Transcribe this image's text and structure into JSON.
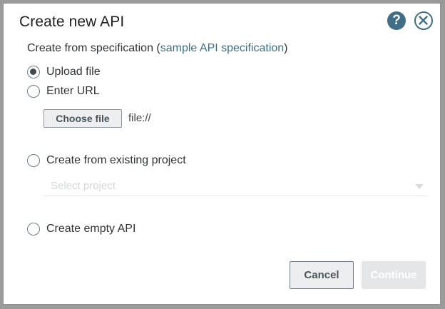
{
  "dialog": {
    "title": "Create new API",
    "help_icon": "question-mark-icon",
    "close_icon": "close-x-icon",
    "help_glyph": "?"
  },
  "spec": {
    "prefix": "Create from specification",
    "open_paren": " (",
    "link_text": "sample API specification",
    "close_paren": ")"
  },
  "options": {
    "upload_file": "Upload file",
    "enter_url": "Enter URL",
    "existing_project": "Create from existing project",
    "empty_api": "Create empty API",
    "selected": "upload_file"
  },
  "file_picker": {
    "button_label": "Choose file",
    "value": "file://"
  },
  "project_select": {
    "placeholder": "Select project"
  },
  "footer": {
    "cancel_label": "Cancel",
    "continue_label": "Continue"
  },
  "colors": {
    "accent": "#3f6e86",
    "link": "#3b6f8a",
    "disabled_button": "#e4e6e8"
  }
}
